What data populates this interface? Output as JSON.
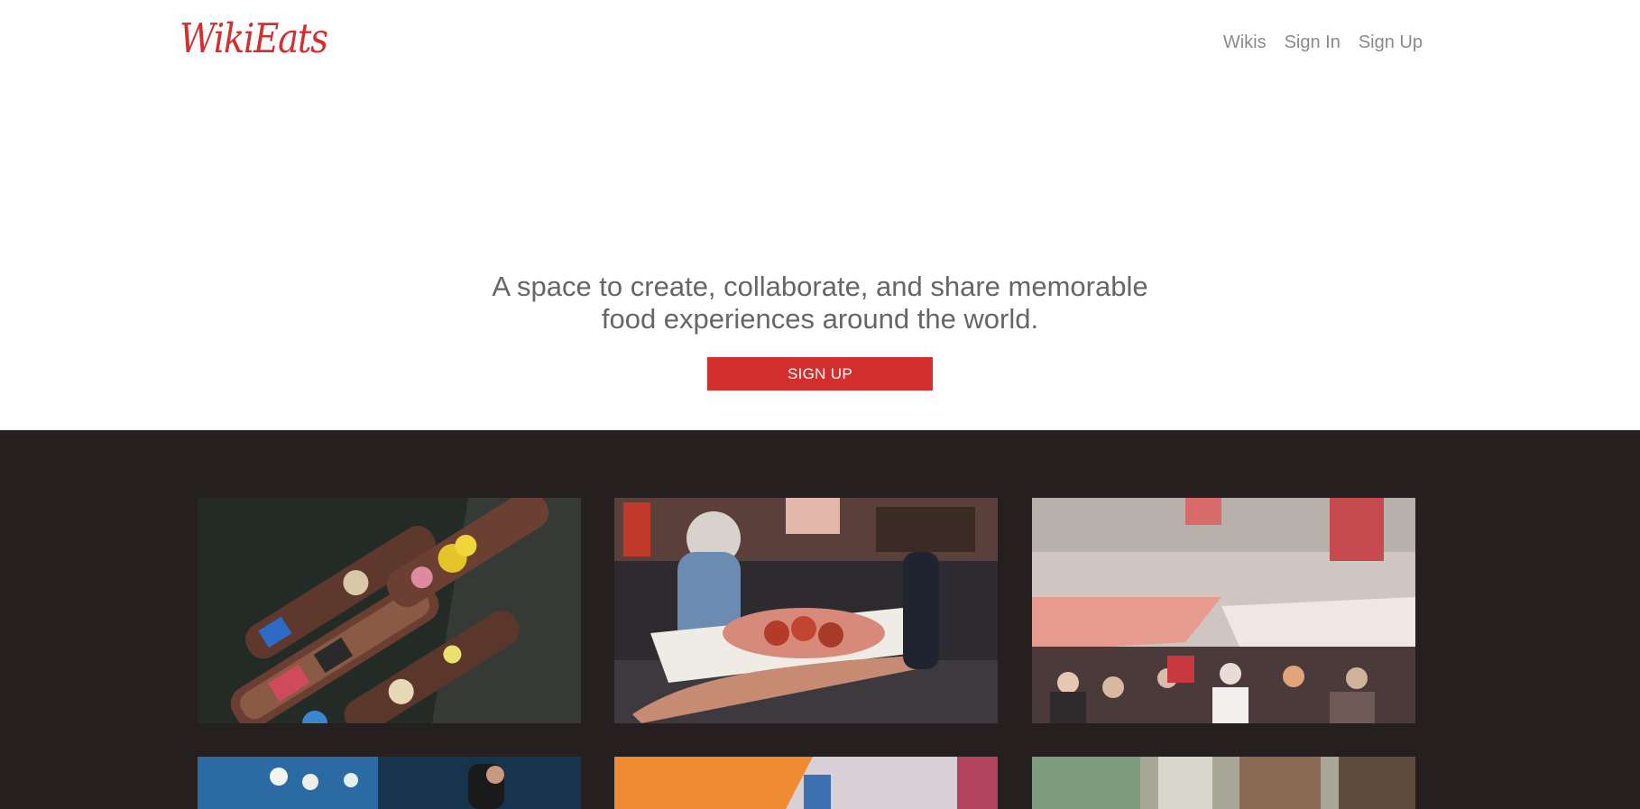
{
  "brand": {
    "name": "WikiEats"
  },
  "nav": {
    "wikis": "Wikis",
    "sign_in": "Sign In",
    "sign_up": "Sign Up"
  },
  "hero": {
    "tagline_line1": "A space to create, collaborate, and share memorable",
    "tagline_line2": "food experiences around the world.",
    "cta_label": "SIGN UP"
  },
  "colors": {
    "accent": "#d32f2f",
    "gallery_bg": "#251f20",
    "text": "#666666"
  },
  "gallery": {
    "photos": [
      "floating-market-boats-photo",
      "street-food-takoyaki-photo",
      "outdoor-market-crowd-photo",
      "night-food-stall-photo",
      "orange-sleeve-street-photo",
      "city-buildings-photo"
    ]
  }
}
